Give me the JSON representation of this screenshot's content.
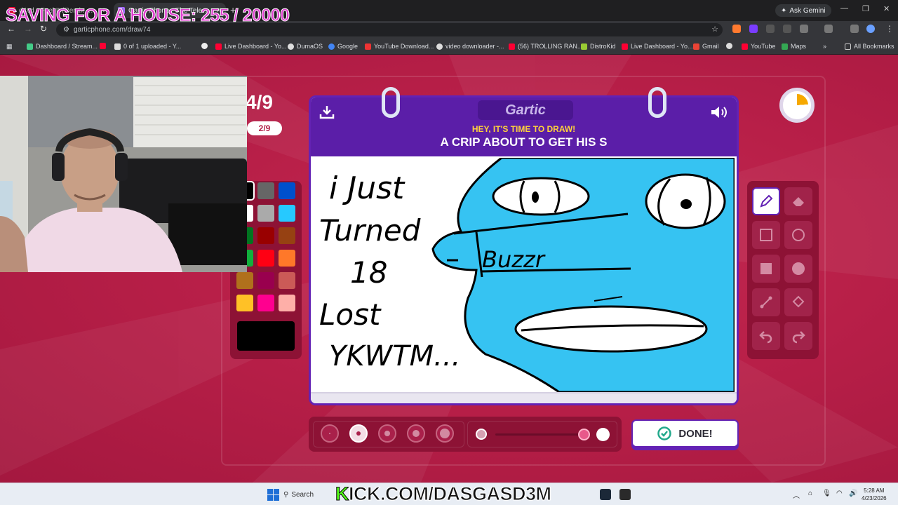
{
  "overlay": {
    "saving_text": "SAVING FOR A HOUSE: 255 / 20000",
    "kick_prefix": "K",
    "kick_rest": "ICK.COM/DASGASD3M"
  },
  "browser": {
    "tabs": [
      {
        "title": "d4vd - Feel It (Remix By I..."
      },
      {
        "title": "Gartic Phone - The Telephone G..."
      }
    ],
    "url": "garticphone.com/draw74",
    "ask_gemini": "Ask Gemini",
    "bookmarks": [
      "Dashboard / Stream...",
      "0 of 1 uploaded - Y...",
      "Live Dashboard - Yo...",
      "DumaOS",
      "Google",
      "YouTube Download...",
      "video downloader -...",
      "(56) TROLLING RAN...",
      "DistroKid",
      "Live Dashboard - Yo...",
      "Gmail",
      "YouTube",
      "Maps"
    ],
    "all_bookmarks": "All Bookmarks"
  },
  "game": {
    "round": "4/9",
    "round_pill": "2/9",
    "logo": "Gartic",
    "prompt_small": "HEY, IT'S TIME TO DRAW!",
    "prompt_big": "A CRIP ABOUT TO GET HIS S",
    "done_label": "DONE!",
    "timer_fraction_elapsed": 0.24,
    "palette": [
      "#000000",
      "#666666",
      "#0050cd",
      "#ffffff",
      "#aaaaaa",
      "#26c9ff",
      "#017420",
      "#990000",
      "#964112",
      "#11b03c",
      "#ff0013",
      "#ff7829",
      "#b0701c",
      "#99004e",
      "#cb5a57",
      "#ffc126",
      "#ff008f",
      "#feafa8"
    ],
    "selected_color": "#000000",
    "drawing_text": [
      "i Just",
      "Turned",
      "18",
      "Lost",
      "YKWTM..."
    ],
    "drawing_mouth_text": "Buzzr"
  },
  "taskbar": {
    "search": "Search",
    "time": "5:28 AM",
    "date": "4/23/2026"
  }
}
